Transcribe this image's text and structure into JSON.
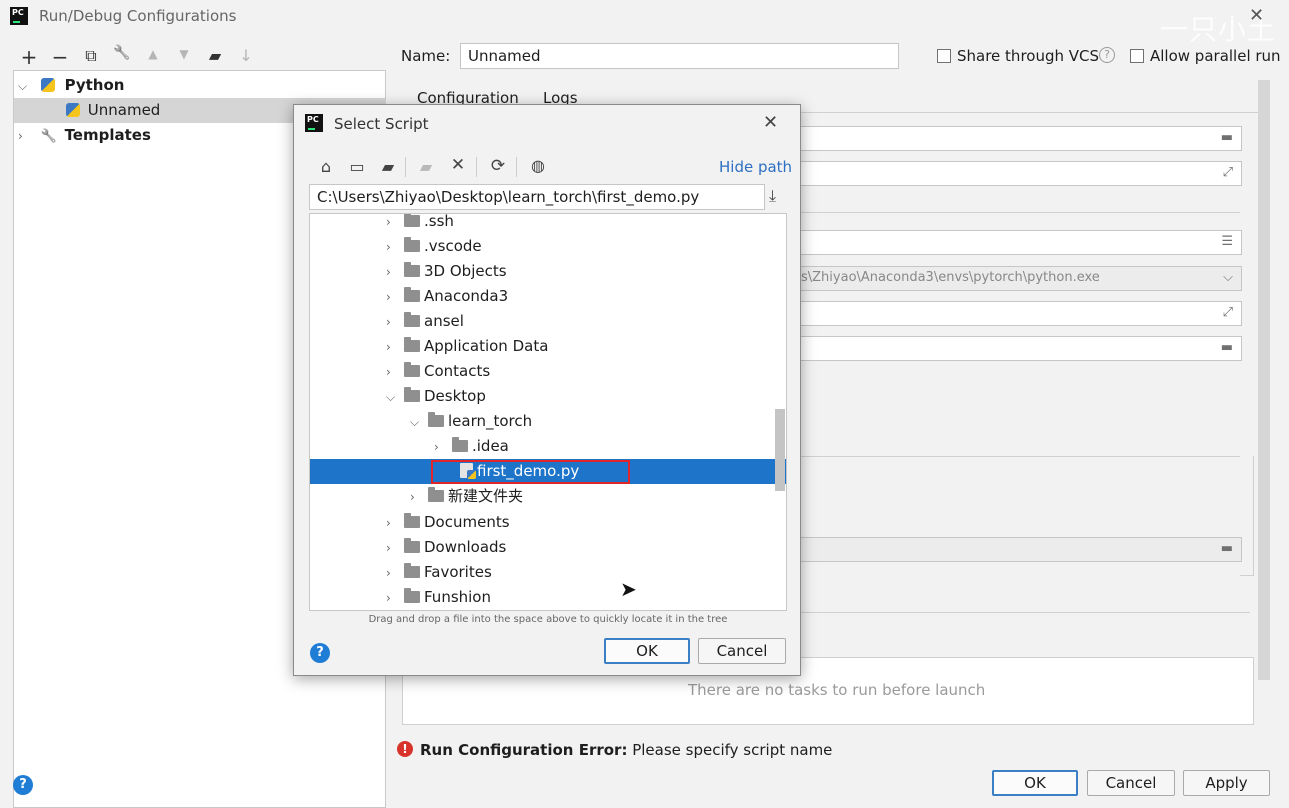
{
  "window": {
    "title": "Run/Debug Configurations",
    "watermark": "一只小土"
  },
  "toolbar": {
    "add": "+",
    "remove": "−",
    "copy": "⧉",
    "edit": "🔧",
    "up": "▲",
    "down": "▼",
    "folder": "▰",
    "sort": "↓"
  },
  "tree": {
    "python_label": "Python",
    "unnamed_label": "Unnamed",
    "templates_label": "Templates"
  },
  "config": {
    "name_label": "Name:",
    "name_value": "Unnamed",
    "share_vcs_label": "Share through VCS",
    "allow_parallel_label": "Allow parallel run",
    "tab_configuration": "Configuration",
    "tab_logs": "Logs",
    "interpreter_value": "s\\Zhiyao\\Anaconda3\\envs\\pytorch\\python.exe",
    "no_tasks_text": "There are no tasks to run before launch",
    "error_label": "Run Configuration Error:",
    "error_message": "Please specify script name"
  },
  "footer": {
    "ok_label": "OK",
    "cancel_label": "Cancel",
    "apply_label": "Apply"
  },
  "dialog": {
    "title": "Select Script",
    "hide_path_label": "Hide path",
    "path_value": "C:\\Users\\Zhiyao\\Desktop\\learn_torch\\first_demo.py",
    "hint_text": "Drag and drop a file into the space above to quickly locate it in the tree",
    "ok_label": "OK",
    "cancel_label": "Cancel",
    "items": [
      {
        "label": ".ssh"
      },
      {
        "label": ".vscode"
      },
      {
        "label": "3D Objects"
      },
      {
        "label": "Anaconda3"
      },
      {
        "label": "ansel"
      },
      {
        "label": "Application Data"
      },
      {
        "label": "Contacts"
      },
      {
        "label": "Desktop"
      },
      {
        "label": "learn_torch"
      },
      {
        "label": ".idea"
      },
      {
        "label": "first_demo.py"
      },
      {
        "label": "新建文件夹"
      },
      {
        "label": "Documents"
      },
      {
        "label": "Downloads"
      },
      {
        "label": "Favorites"
      },
      {
        "label": "Funshion"
      }
    ]
  },
  "colors": {
    "selection": "#1d74c9",
    "highlight_box": "#e0262a",
    "help_blue": "#1f7dd6",
    "error_red": "#d9342b"
  }
}
